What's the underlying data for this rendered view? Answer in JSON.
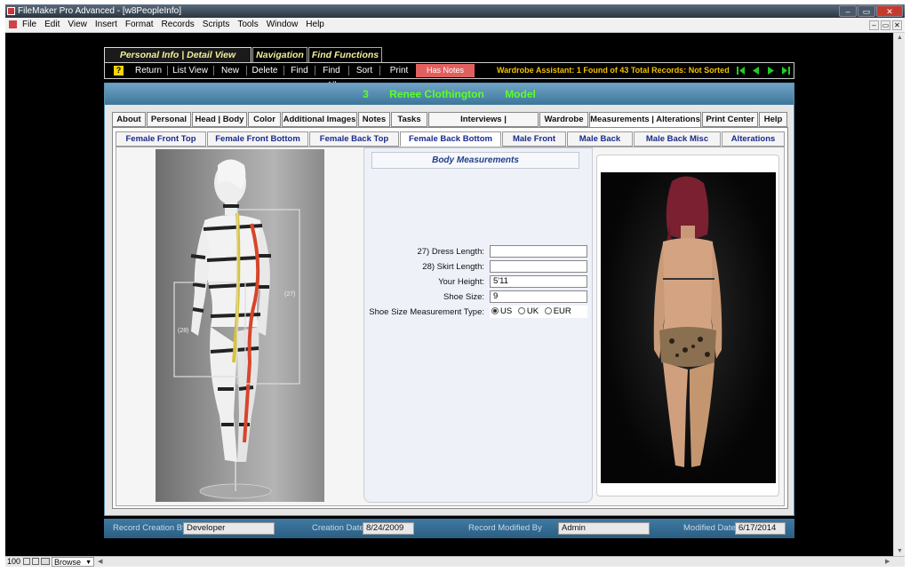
{
  "window": {
    "title": "FileMaker Pro Advanced - [w8PeopleInfo]",
    "minimize": "–",
    "restore": "▭",
    "close": "✕"
  },
  "menu": [
    "File",
    "Edit",
    "View",
    "Insert",
    "Format",
    "Records",
    "Scripts",
    "Tools",
    "Window",
    "Help"
  ],
  "toolbar_tabs": [
    {
      "label": "Personal Info | Detail View Toolbar",
      "active": true
    },
    {
      "label": "Navigation",
      "active": false
    },
    {
      "label": "Find Functions",
      "active": false
    }
  ],
  "toolbar": {
    "help_label": "?",
    "buttons": [
      "Return",
      "List View",
      "New",
      "Delete",
      "Find",
      "Find All",
      "Sort",
      "Print"
    ],
    "has_notes": "Has Notes",
    "assistant": "Wardrobe Assistant:  1 Found of 43 Total Records: Not Sorted"
  },
  "record": {
    "id": "3",
    "name": "Renee Clothington",
    "role": "Model"
  },
  "tabs": [
    {
      "label": "About"
    },
    {
      "label": "Personal"
    },
    {
      "label": "Head | Body"
    },
    {
      "label": "Color"
    },
    {
      "label": "Additional Images"
    },
    {
      "label": "Notes"
    },
    {
      "label": "Tasks"
    },
    {
      "label": "Interviews | Questionnaires"
    },
    {
      "label": "Wardrobe"
    },
    {
      "label": "Measurements | Alterations",
      "active": true
    },
    {
      "label": "Print Center"
    },
    {
      "label": "Help"
    }
  ],
  "subtabs": [
    {
      "label": "Female Front Top"
    },
    {
      "label": "Female Front Bottom"
    },
    {
      "label": "Female Back Top"
    },
    {
      "label": "Female Back Bottom",
      "active": true
    },
    {
      "label": "Male Front"
    },
    {
      "label": "Male Back"
    },
    {
      "label": "Male Back Misc"
    },
    {
      "label": "Alterations"
    }
  ],
  "diagram": {
    "label_27": "(27)",
    "label_28": "(28)"
  },
  "measurements": {
    "title": "Body Measurements",
    "dress_length_label": "27) Dress Length:",
    "dress_length": "",
    "skirt_length_label": "28) Skirt Length:",
    "skirt_length": "",
    "height_label": "Your Height:",
    "height": "5'11",
    "shoe_size_label": "Shoe Size:",
    "shoe_size": "9",
    "shoe_type_label": "Shoe Size Measurement Type:",
    "shoe_type_options": [
      "US",
      "UK",
      "EUR"
    ],
    "shoe_type_selected": "US"
  },
  "footer": {
    "created_by_label": "Record Creation By",
    "created_by": "Developer",
    "creation_date_label": "Creation Date",
    "creation_date": "8/24/2009",
    "modified_by_label": "Record Modified By",
    "modified_by": "Admin",
    "modified_date_label": "Modified Date",
    "modified_date": "6/17/2014"
  },
  "status": {
    "zoom": "100",
    "mode": "Browse"
  },
  "colors": {
    "header_text": "#5bff2a",
    "toolbar_text": "#f0f0a0",
    "assistant": "#f2c200",
    "nav_arrows": "#22cc22",
    "has_notes": "#e06060"
  }
}
